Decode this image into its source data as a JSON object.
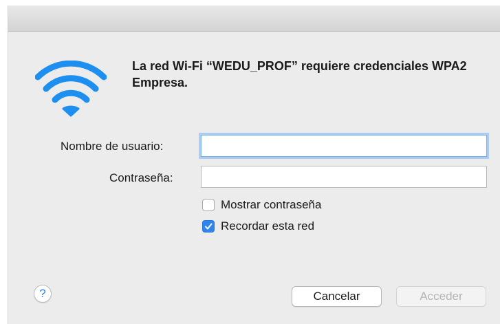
{
  "message": {
    "text": "La red Wi-Fi “WEDU_PROF” requiere credenciales WPA2 Empresa."
  },
  "form": {
    "username_label": "Nombre de usuario:",
    "username_value": "",
    "password_label": "Contraseña:",
    "password_value": ""
  },
  "options": {
    "show_password": {
      "label": "Mostrar contraseña",
      "checked": false
    },
    "remember_network": {
      "label": "Recordar esta red",
      "checked": true
    }
  },
  "buttons": {
    "help_label": "?",
    "cancel_label": "Cancelar",
    "access_label": "Acceder"
  },
  "icons": {
    "wifi": "wifi-icon",
    "checkmark": "checkmark-icon"
  },
  "colors": {
    "wifi_blue": "#1d8ff0",
    "checkbox_blue": "#2f84ee",
    "help_blue": "#2a82e6",
    "focus_ring": "#a9cdf2",
    "disabled_text": "#b4b4b4"
  }
}
